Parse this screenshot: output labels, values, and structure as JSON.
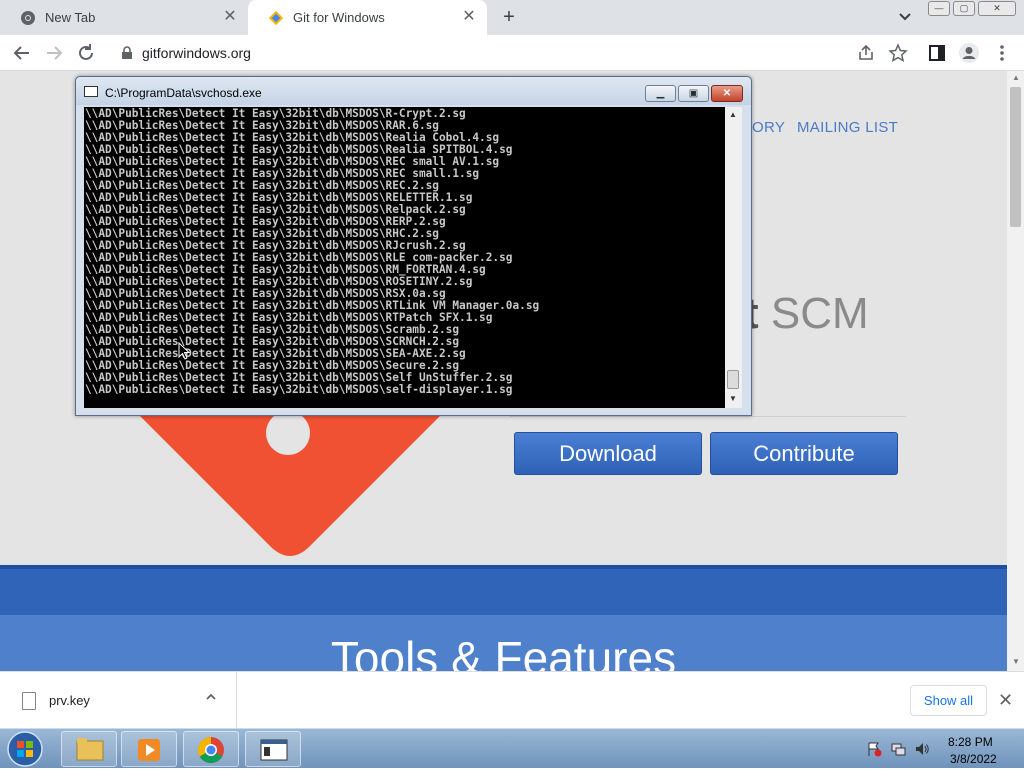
{
  "browser": {
    "tabs": [
      {
        "title": "New Tab",
        "icon": "chrome-icon",
        "active": false
      },
      {
        "title": "Git for Windows",
        "icon": "git-diamond-icon",
        "active": true
      }
    ],
    "close_glyph": "✕",
    "new_tab_glyph": "+",
    "url": "gitforwindows.org"
  },
  "page": {
    "nav_links": [
      "ORY",
      "MAILING LIST"
    ],
    "headline_part_bold": "t",
    "headline_part": " SCM",
    "download_label": "Download",
    "contribute_label": "Contribute",
    "features_heading": "Tools & Features",
    "colors": {
      "accent": "#2f64b8",
      "logo": "#f05133"
    }
  },
  "console": {
    "title": "C:\\ProgramData\\svchosd.exe",
    "lines": [
      "\\\\AD\\PublicRes\\Detect It Easy\\32bit\\db\\MSDOS\\R-Crypt.2.sg",
      "\\\\AD\\PublicRes\\Detect It Easy\\32bit\\db\\MSDOS\\RAR.6.sg",
      "\\\\AD\\PublicRes\\Detect It Easy\\32bit\\db\\MSDOS\\Realia Cobol.4.sg",
      "\\\\AD\\PublicRes\\Detect It Easy\\32bit\\db\\MSDOS\\Realia SPITBOL.4.sg",
      "\\\\AD\\PublicRes\\Detect It Easy\\32bit\\db\\MSDOS\\REC small AV.1.sg",
      "\\\\AD\\PublicRes\\Detect It Easy\\32bit\\db\\MSDOS\\REC small.1.sg",
      "\\\\AD\\PublicRes\\Detect It Easy\\32bit\\db\\MSDOS\\REC.2.sg",
      "\\\\AD\\PublicRes\\Detect It Easy\\32bit\\db\\MSDOS\\RELETTER.1.sg",
      "\\\\AD\\PublicRes\\Detect It Easy\\32bit\\db\\MSDOS\\Relpack.2.sg",
      "\\\\AD\\PublicRes\\Detect It Easy\\32bit\\db\\MSDOS\\RERP.2.sg",
      "\\\\AD\\PublicRes\\Detect It Easy\\32bit\\db\\MSDOS\\RHC.2.sg",
      "\\\\AD\\PublicRes\\Detect It Easy\\32bit\\db\\MSDOS\\RJcrush.2.sg",
      "\\\\AD\\PublicRes\\Detect It Easy\\32bit\\db\\MSDOS\\RLE com-packer.2.sg",
      "\\\\AD\\PublicRes\\Detect It Easy\\32bit\\db\\MSDOS\\RM_FORTRAN.4.sg",
      "\\\\AD\\PublicRes\\Detect It Easy\\32bit\\db\\MSDOS\\ROSETINY.2.sg",
      "\\\\AD\\PublicRes\\Detect It Easy\\32bit\\db\\MSDOS\\RSX.0a.sg",
      "\\\\AD\\PublicRes\\Detect It Easy\\32bit\\db\\MSDOS\\RTLink VM Manager.0a.sg",
      "\\\\AD\\PublicRes\\Detect It Easy\\32bit\\db\\MSDOS\\RTPatch SFX.1.sg",
      "\\\\AD\\PublicRes\\Detect It Easy\\32bit\\db\\MSDOS\\Scramb.2.sg",
      "\\\\AD\\PublicRes\\Detect It Easy\\32bit\\db\\MSDOS\\SCRNCH.2.sg",
      "\\\\AD\\PublicRes\\Detect It Easy\\32bit\\db\\MSDOS\\SEA-AXE.2.sg",
      "\\\\AD\\PublicRes\\Detect It Easy\\32bit\\db\\MSDOS\\Secure.2.sg",
      "\\\\AD\\PublicRes\\Detect It Easy\\32bit\\db\\MSDOS\\Self UnStuffer.2.sg",
      "\\\\AD\\PublicRes\\Detect It Easy\\32bit\\db\\MSDOS\\self-displayer.1.sg"
    ]
  },
  "downloads": {
    "file_name": "prv.key",
    "show_all_label": "Show all"
  },
  "taskbar": {
    "time": "8:28 PM",
    "date": "3/8/2022"
  }
}
